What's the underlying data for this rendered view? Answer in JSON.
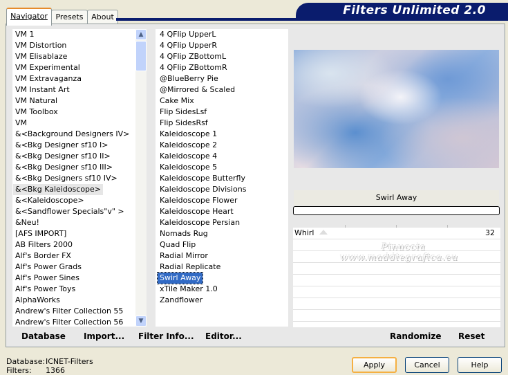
{
  "tabs": [
    {
      "label": "Navigator"
    },
    {
      "label": "Presets"
    },
    {
      "label": "About"
    }
  ],
  "app_title": "Filters Unlimited 2.0",
  "categories": [
    "VM 1",
    "VM Distortion",
    "VM Elisablaze",
    "VM Experimental",
    "VM Extravaganza",
    "VM Instant Art",
    "VM Natural",
    "VM Toolbox",
    "VM",
    "&<Background Designers IV>",
    "&<Bkg Designer sf10 I>",
    "&<Bkg Designer sf10 II>",
    "&<Bkg Designer sf10 III>",
    "&<Bkg Designers sf10 IV>",
    "&<Bkg Kaleidoscope>",
    "&<Kaleidoscope>",
    "&<Sandflower Specials\"v\" >",
    "&Neu!",
    "[AFS IMPORT]",
    "AB Filters 2000",
    "Alf's Border FX",
    "Alf's Power Grads",
    "Alf's Power Sines",
    "Alf's Power Toys",
    "AlphaWorks",
    "Andrew's Filter Collection 55",
    "Andrew's Filter Collection 56"
  ],
  "category_highlight_index": 14,
  "filters": [
    "4 QFlip UpperL",
    "4 QFlip UpperR",
    "4 QFlip ZBottomL",
    "4 QFlip ZBottomR",
    "@BlueBerry Pie",
    "@Mirrored & Scaled",
    "Cake Mix",
    "Flip SidesLsf",
    "Flip SidesRsf",
    "Kaleidoscope 1",
    "Kaleidoscope 2",
    "Kaleidoscope 4",
    "Kaleidoscope 5",
    "Kaleidoscope Butterfly",
    "Kaleidoscope Divisions",
    "Kaleidoscope Flower",
    "Kaleidoscope Heart",
    "Kaleidoscope Persian",
    "Nomads Rug",
    "Quad Flip",
    "Radial Mirror",
    "Radial Replicate",
    "Swirl Away",
    "xTile Maker 1.0",
    "Zandflower"
  ],
  "filter_selected_index": 22,
  "preview": {
    "filter_name": "Swirl Away",
    "progress_percent": 0
  },
  "parameters": [
    {
      "name": "Whirl",
      "value": "32"
    }
  ],
  "watermark": {
    "line1": "Pinuccia",
    "line2": "www.maddiegrafica.eu"
  },
  "bottom_buttons": {
    "database": "Database",
    "import": "Import...",
    "filter_info": "Filter Info...",
    "editor": "Editor...",
    "randomize": "Randomize",
    "reset": "Reset"
  },
  "status": {
    "database_label": "Database:",
    "database_value": "ICNET-Filters",
    "filters_label": "Filters:",
    "filters_value": "1366"
  },
  "dialog_buttons": {
    "apply": "Apply",
    "cancel": "Cancel",
    "help": "Help"
  },
  "colors": {
    "banner": "#0a1c6d",
    "selection": "#316ac5",
    "active_tab_accent": "#e68b2c"
  }
}
